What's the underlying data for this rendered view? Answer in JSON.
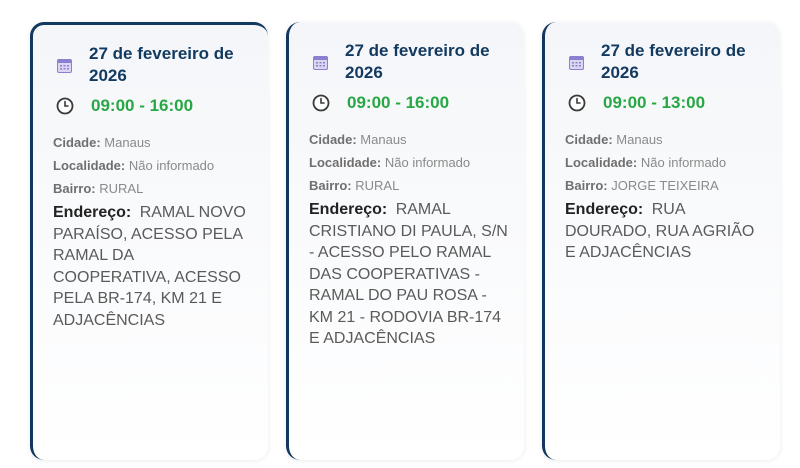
{
  "cards": [
    {
      "date": "27 de fevereiro de 2026",
      "time": "09:00 - 16:00",
      "city_label": "Cidade:",
      "city": "Manaus",
      "locality_label": "Localidade:",
      "locality": "Não informado",
      "district_label": "Bairro:",
      "district": "RURAL",
      "address_label": "Endereço:",
      "address": "RAMAL NOVO PARAÍSO, ACESSO PELA RAMAL DA COOPERATIVA, ACESSO PELA BR-174, KM 21 E ADJACÊNCIAS"
    },
    {
      "date": "27 de fevereiro de 2026",
      "time": "09:00 - 16:00",
      "city_label": "Cidade:",
      "city": "Manaus",
      "locality_label": "Localidade:",
      "locality": "Não informado",
      "district_label": "Bairro:",
      "district": "RURAL",
      "address_label": "Endereço:",
      "address": "RAMAL CRISTIANO DI PAULA, S/N - ACESSO PELO RAMAL DAS COOPERATIVAS - RAMAL DO PAU ROSA - KM 21 - RODOVIA BR-174 E ADJACÊNCIAS"
    },
    {
      "date": "27 de fevereiro de 2026",
      "time": "09:00 - 13:00",
      "city_label": "Cidade:",
      "city": "Manaus",
      "locality_label": "Localidade:",
      "locality": "Não informado",
      "district_label": "Bairro:",
      "district": "JORGE TEIXEIRA",
      "address_label": "Endereço:",
      "address": "RUA DOURADO, RUA AGRIÃO E ADJACÊNCIAS"
    }
  ],
  "icons": {
    "date": "calendar-icon",
    "time": "clock-icon"
  },
  "colors": {
    "accent": "#12395f",
    "time": "#28a745"
  }
}
